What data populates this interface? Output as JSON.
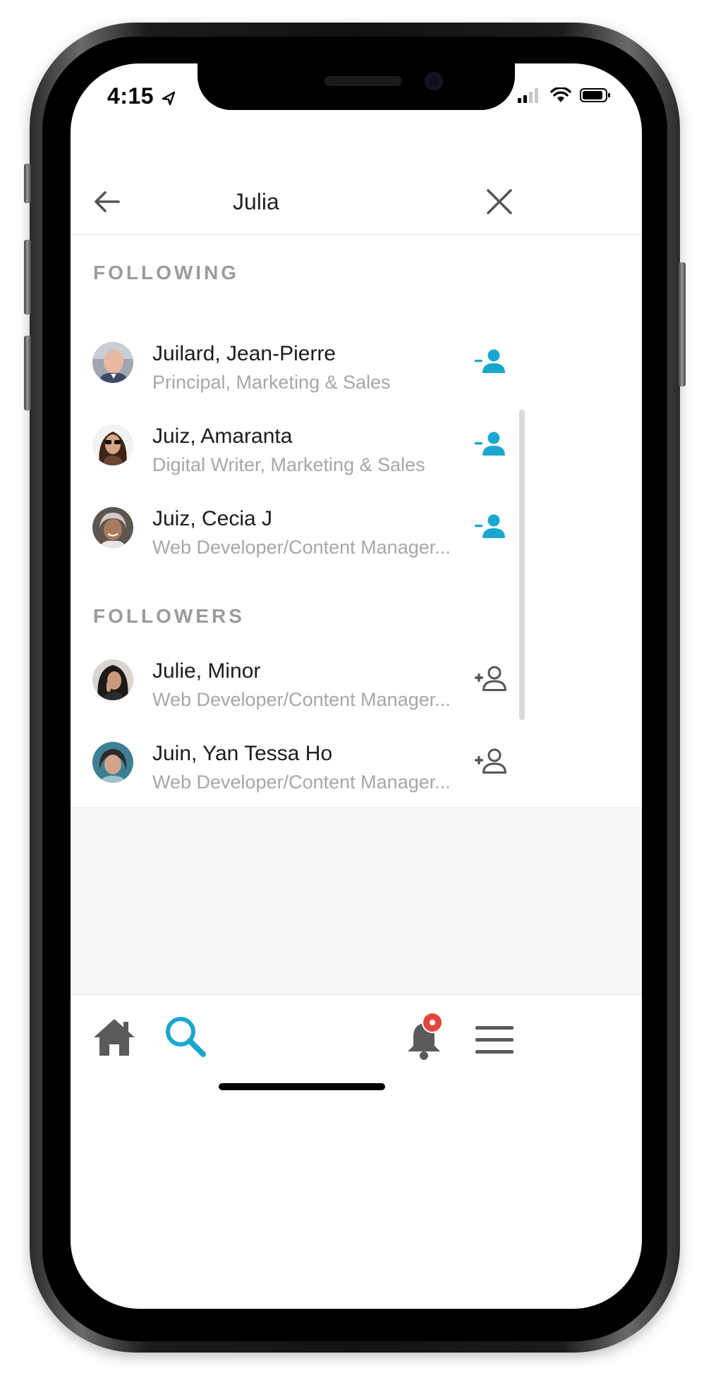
{
  "status_bar": {
    "time": "4:15"
  },
  "header": {
    "search_value": "Julia"
  },
  "sections": [
    {
      "title": "FOLLOWING",
      "items": [
        {
          "name": "Juilard, Jean-Pierre",
          "title": "Principal, Marketing & Sales",
          "follow_state": "following"
        },
        {
          "name": "Juiz, Amaranta",
          "title": "Digital Writer, Marketing & Sales",
          "follow_state": "following"
        },
        {
          "name": "Juiz, Cecia J",
          "title": "Web Developer/Content Manager...",
          "follow_state": "following"
        }
      ]
    },
    {
      "title": "FOLLOWERS",
      "items": [
        {
          "name": "Julie, Minor",
          "title": "Web Developer/Content Manager...",
          "follow_state": "not_following"
        },
        {
          "name": "Juin, Yan Tessa Ho",
          "title": "Web Developer/Content Manager...",
          "follow_state": "not_following"
        }
      ]
    }
  ],
  "tab_bar": {
    "items": [
      {
        "icon": "home-icon",
        "active": false
      },
      {
        "icon": "search-icon",
        "active": true
      },
      {
        "icon": "bell-icon",
        "active": false,
        "badge": true
      },
      {
        "icon": "menu-icon",
        "active": false
      }
    ]
  },
  "colors": {
    "accent": "#1aa7cf",
    "muted_text": "#a7a7a7",
    "section_title": "#9b9b9b",
    "icon_dark": "#5a5a5a",
    "badge": "#e2473f"
  }
}
